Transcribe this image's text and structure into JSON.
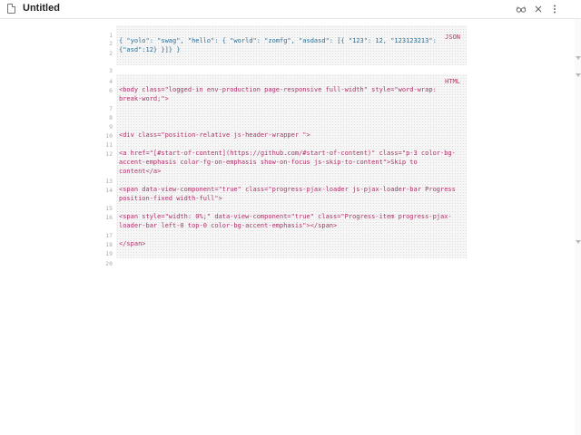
{
  "window": {
    "title": "Untitled",
    "icons": [
      "glasses-icon",
      "close-icon",
      "more-icon"
    ]
  },
  "blocks": {
    "json": {
      "label": "JSON",
      "lines": [
        {
          "n": "1",
          "text": "{ \"yolo\": \"swag\", \"hello\": { \"world\": \"zomfg\", \"asdasd\": [{ \"123\": 12, \"123123213\": {\"asd\":12} }]} }"
        },
        {
          "n": "2",
          "text": ""
        },
        {
          "n": "3",
          "text": ""
        }
      ]
    },
    "html": {
      "label": "HTML",
      "lines": [
        {
          "n": "6",
          "text": "<body class=\"logged-in env-production page-responsive full-width\" style=\"word-wrap: break-word;\">"
        },
        {
          "n": "7",
          "text": ""
        },
        {
          "n": "8",
          "text": ""
        },
        {
          "n": "9",
          "text": ""
        },
        {
          "n": "10",
          "text": "<div class=\"position-relative js-header-wrapper \">"
        },
        {
          "n": "11",
          "text": ""
        },
        {
          "n": "12",
          "text": "<a href=\"[#start-of-content](https://github.com/#start-of-content)\" class=\"p-3 color-bg-accent-emphasis color-fg-on-emphasis show-on-focus js-skip-to-content\">Skip to content</a>"
        },
        {
          "n": "13",
          "text": ""
        },
        {
          "n": "14",
          "text": "<span data-view-component=\"true\" class=\"progress-pjax-loader js-pjax-loader-bar Progress position-fixed width-full\">"
        },
        {
          "n": "15",
          "text": ""
        },
        {
          "n": "16",
          "text": "<span style=\"width: 0%;\" data-view-component=\"true\" class=\"Progress-item progress-pjax-loader-bar left-0 top-0 color-bg-accent-emphasis\"></span>"
        },
        {
          "n": "17",
          "text": ""
        },
        {
          "n": "18",
          "text": "</span>"
        },
        {
          "n": "19",
          "text": ""
        }
      ]
    },
    "between_lines": [
      {
        "n": "4"
      },
      {
        "n": "5"
      }
    ],
    "after_lines": [
      {
        "n": "20"
      }
    ]
  }
}
